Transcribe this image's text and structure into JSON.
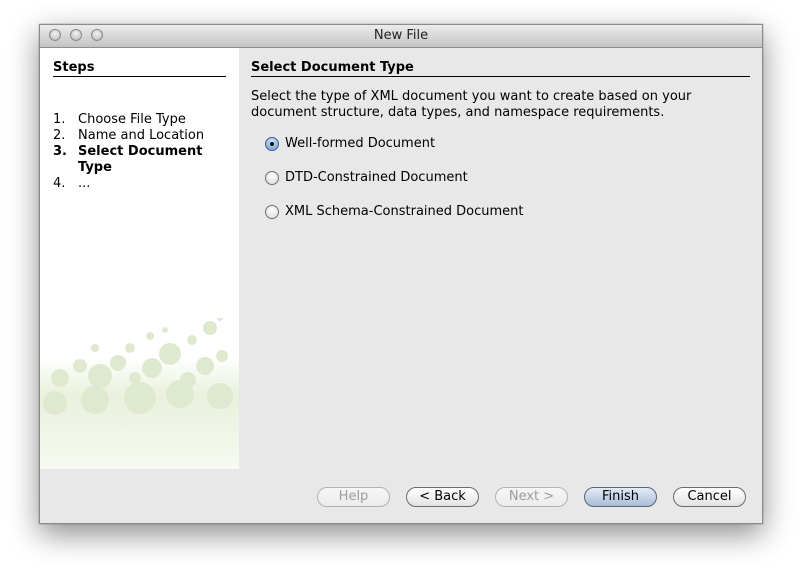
{
  "window": {
    "title": "New File"
  },
  "steps": {
    "heading": "Steps",
    "items": [
      {
        "num": "1.",
        "label": "Choose File Type"
      },
      {
        "num": "2.",
        "label": "Name and Location"
      },
      {
        "num": "3.",
        "label": "Select Document Type"
      },
      {
        "num": "4.",
        "label": "..."
      }
    ],
    "current_index": 2
  },
  "content": {
    "heading": "Select Document Type",
    "description": "Select the type of XML document you want to create based on your document structure, data types, and namespace requirements.",
    "options": [
      {
        "label": "Well-formed Document",
        "selected": true
      },
      {
        "label": "DTD-Constrained Document",
        "selected": false
      },
      {
        "label": "XML Schema-Constrained Document",
        "selected": false
      }
    ]
  },
  "buttons": {
    "help": "Help",
    "back": "< Back",
    "next": "Next >",
    "finish": "Finish",
    "cancel": "Cancel"
  }
}
